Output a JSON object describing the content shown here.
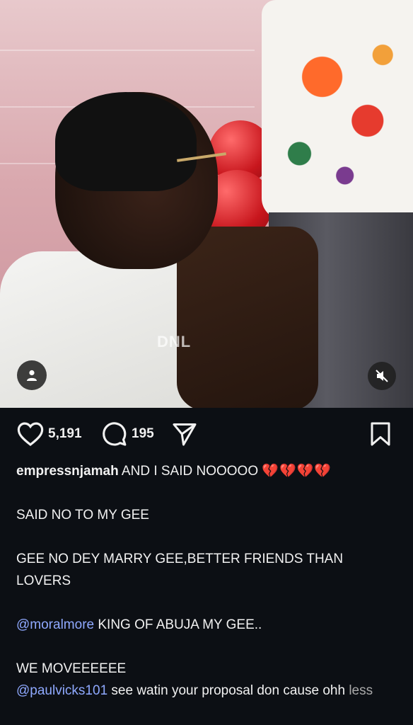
{
  "media": {
    "watermark": "DNL"
  },
  "actions": {
    "like_count": "5,191",
    "comment_count": "195"
  },
  "caption": {
    "username": "empressnjamah",
    "headline": "AND I SAID NOOOOO",
    "hearts": "💔💔💔💔",
    "line1": "SAID NO TO MY GEE",
    "line2": "GEE NO DEY MARRY GEE,BETTER FRIENDS THAN LOVERS",
    "mention1": "@moralmore",
    "line3_rest": " KING OF ABUJA MY GEE..",
    "line4": "WE MOVEEEEEE",
    "mention2": "@paulvicks101",
    "line5_rest": " see watin your proposal don cause ohh",
    "more_link": "less"
  },
  "colors": {
    "background": "#0c0f14",
    "text": "#f1f1f1",
    "mention": "#8fa9ff",
    "muted": "#a9a9a9"
  },
  "icons": {
    "avatar": "person-icon",
    "mute": "speaker-muted-icon",
    "like": "heart-icon",
    "comment": "comment-bubble-icon",
    "share": "paper-plane-icon",
    "save": "bookmark-icon"
  }
}
